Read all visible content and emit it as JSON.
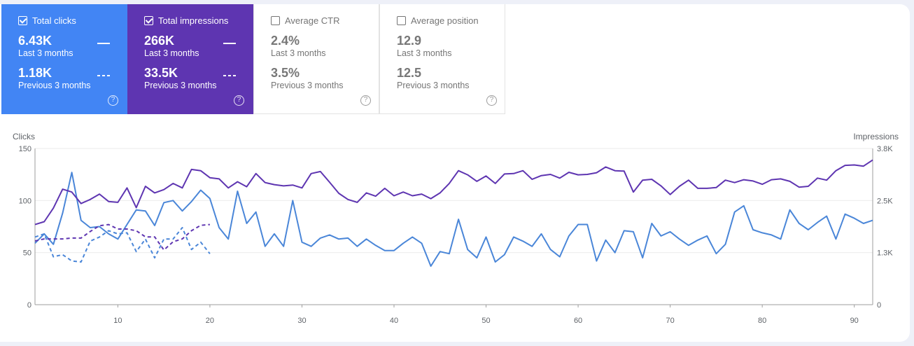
{
  "metrics": [
    {
      "label": "Total clicks",
      "checked": true,
      "color": "#4285f4",
      "current_value": "6.43K",
      "current_period": "Last 3 months",
      "previous_value": "1.18K",
      "previous_period": "Previous 3 months",
      "help": "?"
    },
    {
      "label": "Total impressions",
      "checked": true,
      "color": "#5e35b1",
      "current_value": "266K",
      "current_period": "Last 3 months",
      "previous_value": "33.5K",
      "previous_period": "Previous 3 months",
      "help": "?"
    },
    {
      "label": "Average CTR",
      "checked": false,
      "color": "#ffffff",
      "current_value": "2.4%",
      "current_period": "Last 3 months",
      "previous_value": "3.5%",
      "previous_period": "Previous 3 months",
      "help": "?"
    },
    {
      "label": "Average position",
      "checked": false,
      "color": "#ffffff",
      "current_value": "12.9",
      "current_period": "Last 3 months",
      "previous_value": "12.5",
      "previous_period": "Previous 3 months",
      "help": "?"
    }
  ],
  "chart_data": {
    "type": "line",
    "ylabel_left": "Clicks",
    "ylabel_right": "Impressions",
    "ylim_left": [
      0,
      150
    ],
    "ylim_right": [
      0,
      3800
    ],
    "yticks_left": [
      "0",
      "50",
      "100",
      "150"
    ],
    "yticks_right": [
      "0",
      "1.3K",
      "2.5K",
      "3.8K"
    ],
    "xlim": [
      1,
      92
    ],
    "xticks": [
      10,
      20,
      30,
      40,
      50,
      60,
      70,
      80,
      90
    ],
    "grid": true,
    "series": [
      {
        "metric": "clicks",
        "period": "current",
        "color": "#4a86d8",
        "style": "solid",
        "x_start": 1,
        "values": [
          59,
          68,
          58,
          88,
          127,
          81,
          74,
          75,
          68,
          63,
          77,
          91,
          90,
          76,
          98,
          100,
          90,
          99,
          110,
          102,
          74,
          63,
          109,
          78,
          89,
          56,
          68,
          56,
          100,
          60,
          56,
          64,
          67,
          63,
          64,
          56,
          63,
          57,
          52,
          52,
          59,
          65,
          59,
          37,
          51,
          49,
          82,
          53,
          45,
          65,
          41,
          48,
          65,
          61,
          56,
          68,
          53,
          46,
          66,
          77,
          77,
          42,
          62,
          50,
          71,
          70,
          45,
          78,
          66,
          70,
          63,
          57,
          62,
          66,
          49,
          58,
          89,
          95,
          72,
          69,
          67,
          63,
          91,
          78,
          72,
          79,
          85,
          63,
          87,
          83,
          78,
          81
        ]
      },
      {
        "metric": "impressions",
        "period": "current",
        "color": "#5e35b1",
        "style": "solid",
        "x_start": 1,
        "values": [
          1950,
          2020,
          2350,
          2810,
          2740,
          2460,
          2560,
          2690,
          2510,
          2490,
          2840,
          2360,
          2880,
          2720,
          2800,
          2950,
          2840,
          3290,
          3260,
          3090,
          3060,
          2840,
          2990,
          2870,
          3190,
          2970,
          2920,
          2890,
          2910,
          2840,
          3190,
          3240,
          2980,
          2710,
          2560,
          2490,
          2720,
          2640,
          2830,
          2650,
          2740,
          2650,
          2690,
          2580,
          2720,
          2950,
          3260,
          3160,
          3000,
          3130,
          2950,
          3180,
          3190,
          3260,
          3050,
          3140,
          3170,
          3080,
          3220,
          3160,
          3170,
          3210,
          3350,
          3260,
          3250,
          2740,
          3030,
          3050,
          2890,
          2680,
          2880,
          3030,
          2830,
          2830,
          2850,
          3030,
          2970,
          3040,
          3010,
          2930,
          3040,
          3060,
          3000,
          2860,
          2880,
          3080,
          3030,
          3260,
          3390,
          3400,
          3370,
          3520
        ]
      },
      {
        "metric": "clicks",
        "period": "previous",
        "color": "#4a86d8",
        "style": "dashed",
        "x_start": 1,
        "values": [
          65,
          68,
          46,
          48,
          42,
          41,
          61,
          65,
          71,
          68,
          69,
          51,
          63,
          45,
          63,
          63,
          74,
          53,
          60,
          49
        ]
      },
      {
        "metric": "impressions",
        "period": "previous",
        "color": "#5e35b1",
        "style": "dashed",
        "x_start": 1,
        "values": [
          1550,
          1600,
          1600,
          1600,
          1620,
          1620,
          1780,
          1920,
          1950,
          1840,
          1840,
          1800,
          1650,
          1650,
          1330,
          1530,
          1600,
          1800,
          1930,
          1950
        ]
      }
    ]
  }
}
